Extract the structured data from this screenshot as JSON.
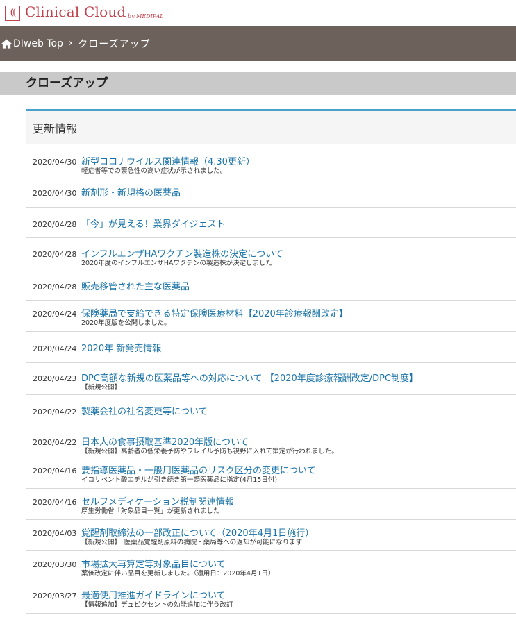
{
  "logo": {
    "mark": "((",
    "title": "Clinical Cloud",
    "sub": "by MEDIPAL"
  },
  "breadcrumb": {
    "home_label": "DIweb Top",
    "separator": "›",
    "current": "クローズアップ"
  },
  "page_title": "クローズアップ",
  "panel": {
    "heading": "更新情報",
    "items": [
      {
        "date": "2020/04/30",
        "title": "新型コロナウイルス関連情報（4.30更新）",
        "desc": "軽症者等での緊急性の高い症状が示されました。"
      },
      {
        "date": "2020/04/30",
        "title": "新剤形・新規格の医薬品",
        "desc": ""
      },
      {
        "date": "2020/04/28",
        "title": "「今」が見える！業界ダイジェスト",
        "desc": ""
      },
      {
        "date": "2020/04/28",
        "title": "インフルエンザHAワクチン製造株の決定について",
        "desc": "2020年度のインフルエンザHAワクチンの製造株が決定しました"
      },
      {
        "date": "2020/04/28",
        "title": "販売移管された主な医薬品",
        "desc": ""
      },
      {
        "date": "2020/04/24",
        "title": "保険薬局で支給できる特定保険医療材料【2020年診療報酬改定】",
        "desc": "2020年度版を公開しました。"
      },
      {
        "date": "2020/04/24",
        "title": "2020年 新発売情報",
        "desc": ""
      },
      {
        "date": "2020/04/23",
        "title": "DPC高額な新規の医薬品等への対応について 【2020年度診療報酬改定/DPC制度】",
        "desc": "【新規公開】"
      },
      {
        "date": "2020/04/22",
        "title": "製薬会社の社名変更等について",
        "desc": ""
      },
      {
        "date": "2020/04/22",
        "title": "日本人の食事摂取基準2020年版について",
        "desc": "【新規公開】高齢者の低栄養予防やフレイル予防も視野に入れて策定が行われました。"
      },
      {
        "date": "2020/04/16",
        "title": "要指導医薬品・一般用医薬品のリスク区分の変更について",
        "desc": "イコサペント酸エチルが引き続き第一類医薬品に指定(4月15日付)"
      },
      {
        "date": "2020/04/16",
        "title": "セルフメディケーション税制関連情報",
        "desc": "厚生労働省「対象品目一覧」が更新されました"
      },
      {
        "date": "2020/04/03",
        "title": "覚醒剤取締法の一部改正について（2020年4月1日施行）",
        "desc": "【新規公開】　医薬品覚醒剤原料の病院・薬局等への返却が可能になります"
      },
      {
        "date": "2020/03/30",
        "title": "市場拡大再算定等対象品目について",
        "desc": "薬価改定に伴い品目を更新しました。（適用日：2020年4月1日）"
      },
      {
        "date": "2020/03/27",
        "title": "最適使用推進ガイドラインについて",
        "desc": "【情報追加】デュピクセントの効能追加に伴う改訂"
      }
    ]
  },
  "colors": {
    "brand": "#c0444e",
    "crumb_bg": "#6c615b",
    "title_bg": "#c9c9c9",
    "accent": "#4aa1cb",
    "link": "#1a73a8"
  }
}
